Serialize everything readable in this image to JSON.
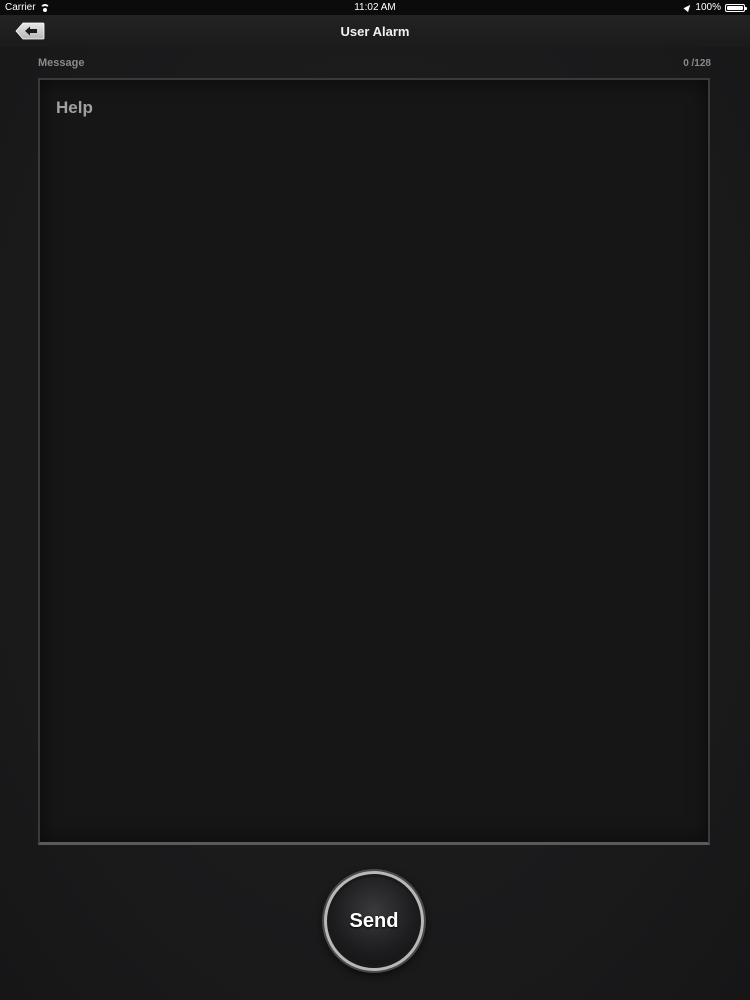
{
  "status_bar": {
    "carrier": "Carrier",
    "time": "11:02 AM",
    "battery": "100%"
  },
  "nav": {
    "title": "User Alarm",
    "back_icon": "back-arrow-icon"
  },
  "form": {
    "message_label": "Message",
    "char_count": "0 /128",
    "message_value": "Help"
  },
  "actions": {
    "send_label": "Send"
  },
  "colors": {
    "background": "#1a1a1b",
    "nav_bar": "#1f1f20",
    "text_primary": "#ffffff",
    "text_muted": "#8a8a8a"
  }
}
